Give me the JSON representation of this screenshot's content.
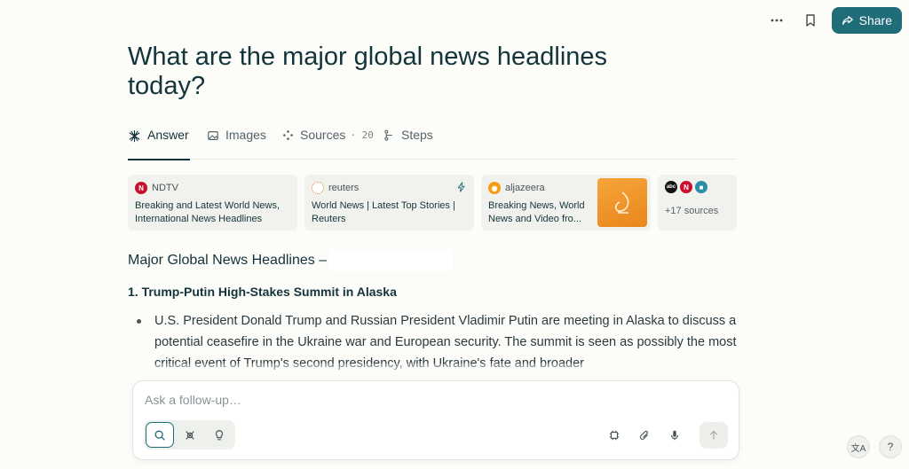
{
  "header": {
    "share_label": "Share",
    "more_icon": "more-horizontal-icon",
    "bookmark_icon": "bookmark-icon"
  },
  "query": {
    "title": "What are the major global news headlines today?"
  },
  "tabs": [
    {
      "label": "Answer",
      "icon": "answer-icon",
      "active": true
    },
    {
      "label": "Images",
      "icon": "image-icon"
    },
    {
      "label": "Sources",
      "icon": "sources-icon",
      "count": "20"
    },
    {
      "label": "Steps",
      "icon": "steps-icon"
    }
  ],
  "sources": [
    {
      "site": "NDTV",
      "title": "Breaking and Latest World News, International News Headlines"
    },
    {
      "site": "reuters",
      "title": "World News | Latest Top Stories | Reuters"
    },
    {
      "site": "aljazeera",
      "title": "Breaking News, World News and Video fro..."
    },
    {
      "more": "+17 sources"
    }
  ],
  "answer": {
    "heading": "Major Global News Headlines –",
    "section1_title": "1. Trump-Putin High-Stakes Summit in Alaska",
    "bullet1": "U.S. President Donald Trump and Russian President Vladimir Putin are meeting in Alaska to discuss a potential ceasefire in the Ukraine war and European security. The summit is seen as possibly the most critical event of Trump's second presidency, with Ukraine's fate and broader"
  },
  "composer": {
    "placeholder": "Ask a follow-up…"
  },
  "footer": {
    "translate_glyph": "文A",
    "help_glyph": "?"
  },
  "colors": {
    "accent": "#1f6d79",
    "background": "#fcfcf9",
    "text": "#13343b"
  }
}
